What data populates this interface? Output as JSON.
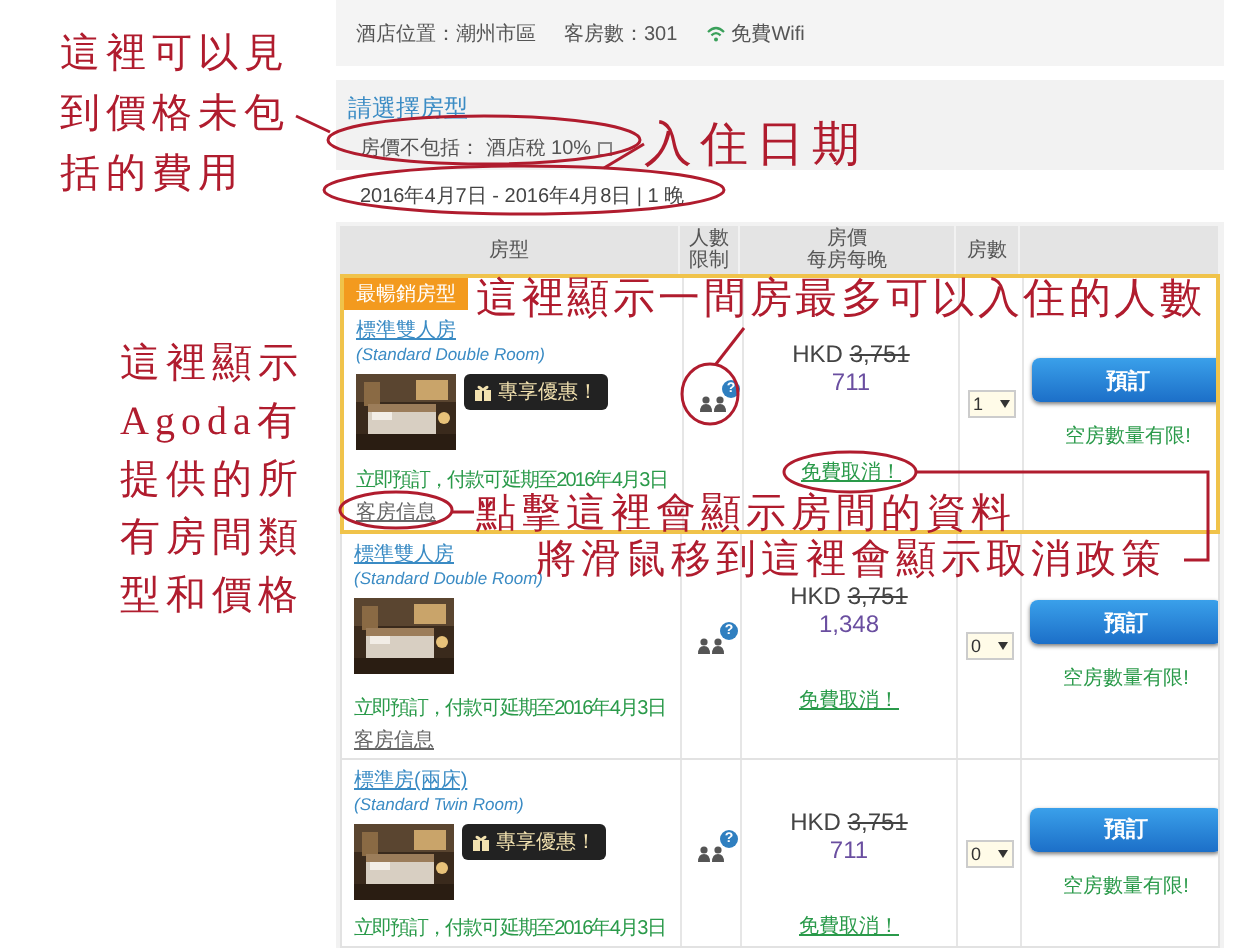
{
  "hotel_info": {
    "location": "酒店位置：潮州市區",
    "rooms": "客房數：301",
    "wifi": "免費Wifi"
  },
  "section": {
    "title": "請選擇房型",
    "excluded": "房價不包括： 酒店稅 10%",
    "dates": "2016年4月7日 - 2016年4月8日 | 1 晚"
  },
  "table": {
    "columns": [
      {
        "label": "房型"
      },
      {
        "label": "人數限制"
      },
      {
        "label": "房價",
        "sub": "每房每晚"
      },
      {
        "label": "房數"
      }
    ],
    "rows": [
      {
        "highlighted": true,
        "badge": "最暢銷房型",
        "name": "標準雙人房",
        "name_en": "(Standard Double Room)",
        "promo": "專享優惠！",
        "pay_later": "立即預訂，付款可延期至2016年4月3日",
        "info_link": "客房信息",
        "help": "?",
        "currency": "HKD",
        "original_price": "3,751",
        "price": "711",
        "cancel": "免費取消！",
        "quantity": "1",
        "book": "預訂",
        "availability": "空房數量有限!"
      },
      {
        "highlighted": false,
        "name": "標準雙人房",
        "name_en": "(Standard Double Room)",
        "pay_later": "立即預訂，付款可延期至2016年4月3日",
        "info_link": "客房信息",
        "help": "?",
        "currency": "HKD",
        "original_price": "3,751",
        "price": "1,348",
        "cancel": "免費取消！",
        "quantity": "0",
        "book": "預訂",
        "availability": "空房數量有限!"
      },
      {
        "highlighted": false,
        "name": "標準房(兩床)",
        "name_en": "(Standard Twin Room)",
        "promo": "專享優惠！",
        "pay_later": "立即預訂，付款可延期至2016年4月3日",
        "help": "?",
        "currency": "HKD",
        "original_price": "3,751",
        "price": "711",
        "cancel": "免費取消！",
        "quantity": "0",
        "book": "預訂",
        "availability": "空房數量有限!"
      }
    ]
  },
  "annotations": [
    {
      "text": "這裡可以見到價格未包括的費用"
    },
    {
      "text": "入住日期"
    },
    {
      "text": "這裡顯示一間房最多可以入住的人數"
    },
    {
      "text": "這裡顯示Agoda有提供的所有房間類型和價格"
    },
    {
      "text": "點擊這裡會顯示房間的資料"
    },
    {
      "text": "將滑鼠移到這裡會顯示取消政策"
    }
  ]
}
